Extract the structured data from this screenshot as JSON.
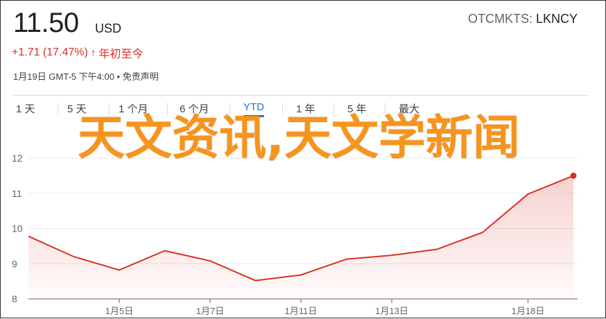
{
  "quote": {
    "price": "11.50",
    "currency": "USD",
    "exchange": "OTCMKTS: ",
    "symbol": "LKNCY",
    "change": "+1.71 (17.47%)",
    "change_arrow": "↑",
    "change_period": "年初至今",
    "timestamp": "1月19日 GMT-5 下午4:00 • 免责声明"
  },
  "tabs": [
    {
      "label": "1 天"
    },
    {
      "label": "5 天"
    },
    {
      "label": "1 个月"
    },
    {
      "label": "6 个月"
    },
    {
      "label": "YTD",
      "active": true
    },
    {
      "label": "1 年"
    },
    {
      "label": "5 年"
    },
    {
      "label": "最大"
    }
  ],
  "overlay_text": "天文资讯,天文学新闻",
  "colors": {
    "line": "#d93025",
    "accent": "#1a73e8",
    "overlay": "#f7941d"
  },
  "chart_data": {
    "type": "area",
    "ylim": [
      8,
      12
    ],
    "yticks": [
      "8",
      "9",
      "10",
      "11",
      "12"
    ],
    "xticks": [
      "1月5日",
      "1月7日",
      "1月11日",
      "1月13日",
      "1月18日"
    ],
    "x": [
      "1月2日",
      "1月4日",
      "1月5日",
      "1月6日",
      "1月7日",
      "1月8日",
      "1月11日",
      "1月12日",
      "1月13日",
      "1月14日",
      "1月15日",
      "1月18日",
      "1月19日"
    ],
    "y": [
      9.78,
      9.2,
      8.82,
      9.37,
      9.08,
      8.52,
      8.68,
      9.13,
      9.24,
      9.41,
      9.89,
      10.98,
      11.5
    ]
  }
}
